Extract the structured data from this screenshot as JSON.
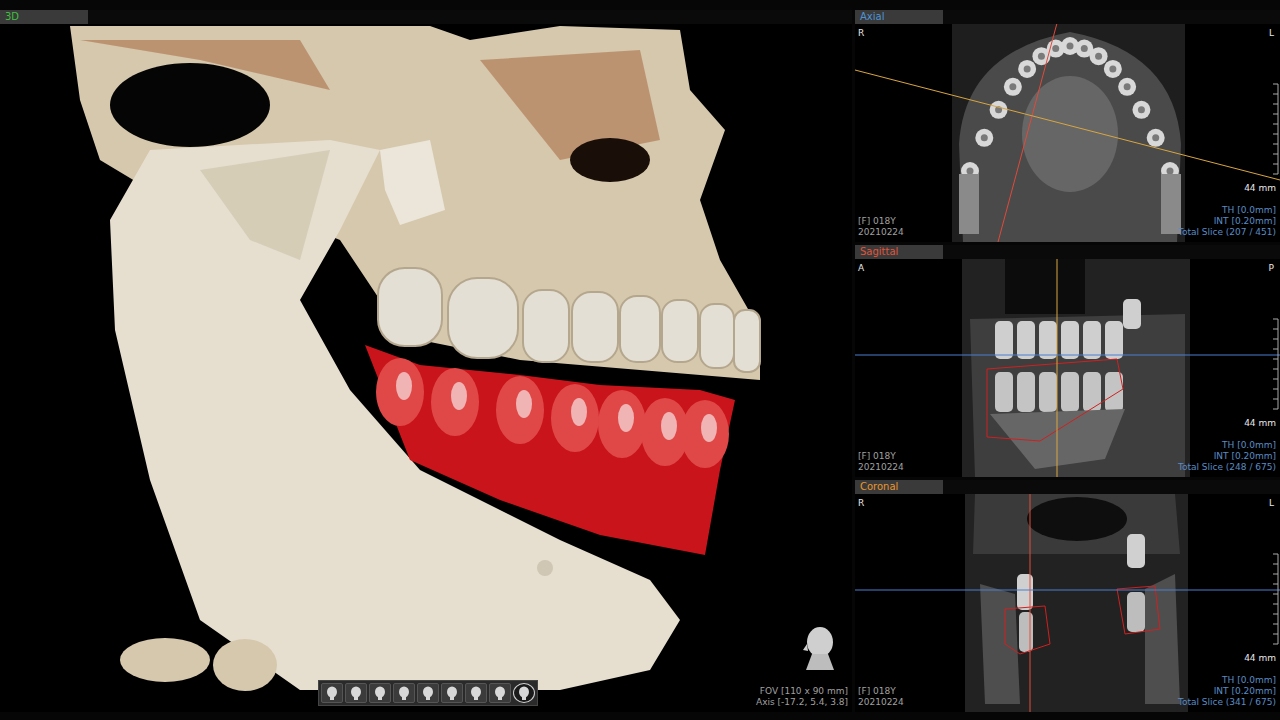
{
  "main_view": {
    "title": "3D",
    "fov": "FOV [110 x 90 mm]",
    "axis": "Axis [-17.2, 5.4, 3.8]",
    "toolbar": [
      {
        "selected": false
      },
      {
        "selected": false
      },
      {
        "selected": false
      },
      {
        "selected": false
      },
      {
        "selected": false
      },
      {
        "selected": false
      },
      {
        "selected": false
      },
      {
        "selected": false
      },
      {
        "selected": true
      }
    ]
  },
  "slice_views": [
    {
      "kind": "axial",
      "title": "Axial",
      "color": "#4f94d4",
      "left": "R",
      "right": "L",
      "patient": "[F] 018Y",
      "date": "20210224",
      "scale": "44 mm",
      "thickness": "TH [0.0mm]",
      "interval": "INT [0.20mm]",
      "slices": "Total Slice (207 / 451)"
    },
    {
      "kind": "sagittal",
      "title": "Sagittal",
      "color": "#e0553a",
      "left": "A",
      "right": "P",
      "patient": "[F] 018Y",
      "date": "20210224",
      "scale": "44 mm",
      "thickness": "TH [0.0mm]",
      "interval": "INT [0.20mm]",
      "slices": "Total Slice (248 / 675)"
    },
    {
      "kind": "coronal",
      "title": "Coronal",
      "color": "#e8962e",
      "left": "R",
      "right": "L",
      "patient": "[F] 018Y",
      "date": "20210224",
      "scale": "44 mm",
      "thickness": "TH [0.0mm]",
      "interval": "INT [0.20mm]",
      "slices": "Total Slice (341 / 675)"
    }
  ]
}
